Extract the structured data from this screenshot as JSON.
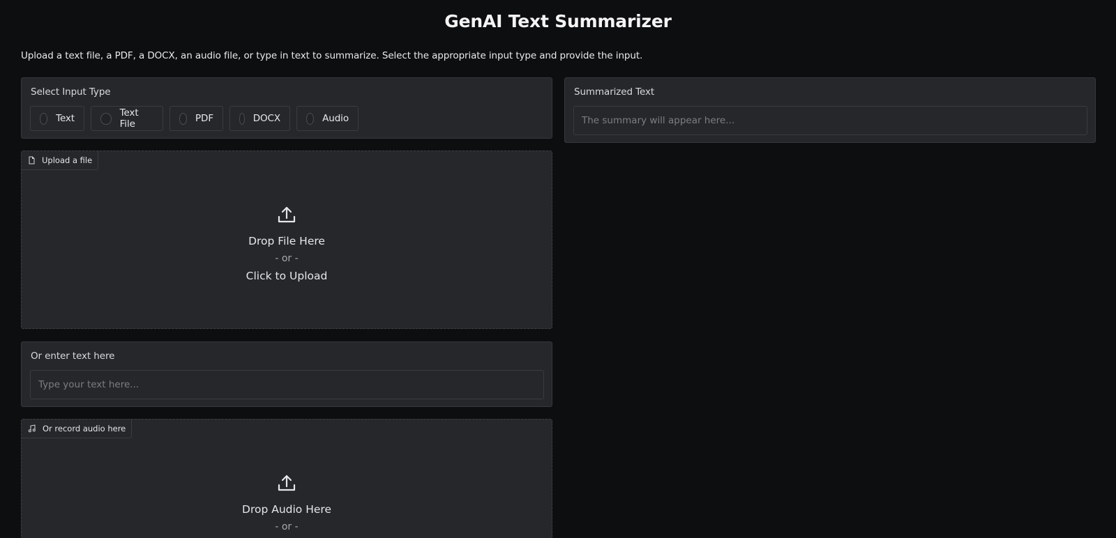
{
  "app": {
    "title": "GenAI Text Summarizer",
    "description": "Upload a text file, a PDF, a DOCX, an audio file, or type in text to summarize. Select the appropriate input type and provide the input."
  },
  "input_type": {
    "label": "Select Input Type",
    "options": [
      "Text",
      "Text File",
      "PDF",
      "DOCX",
      "Audio"
    ],
    "selected": null
  },
  "file_upload": {
    "chip_label": "Upload a file",
    "chip_icon": "file-icon",
    "icon": "upload-icon",
    "drop_text": "Drop File Here",
    "or_text": "- or -",
    "click_text": "Click to Upload"
  },
  "text_entry": {
    "label": "Or enter text here",
    "placeholder": "Type your text here..."
  },
  "audio_upload": {
    "chip_label": "Or record audio here",
    "chip_icon": "music-icon",
    "icon": "upload-icon",
    "drop_text": "Drop Audio Here",
    "or_text": "- or -"
  },
  "summary": {
    "label": "Summarized Text",
    "placeholder": "The summary will appear here..."
  },
  "colors": {
    "background": "#0d0e10",
    "panel": "#26272a",
    "border": "#37383c"
  }
}
